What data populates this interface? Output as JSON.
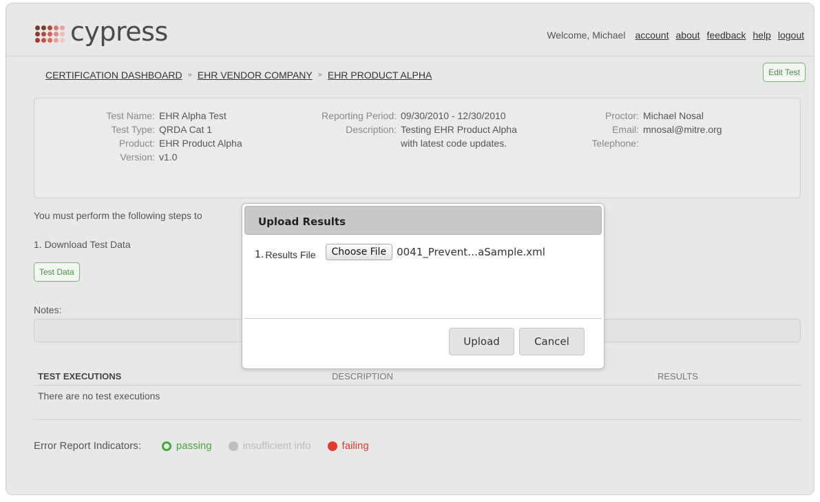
{
  "brand": {
    "name": "cypress",
    "dot_colors": [
      "#7a3a2a",
      "#7a3a2a",
      "#a84a37",
      "#d9786a",
      "#e7a39b",
      "#8e3b2a",
      "#b44a3a",
      "#d0625a",
      "#e08c83",
      "#ecbcb5",
      "#a13c2d",
      "#c8503f",
      "#dc6e63",
      "#e9a097",
      "#f2c8c2"
    ]
  },
  "topnav": {
    "welcome": "Welcome, Michael",
    "links": [
      "account",
      "about",
      "feedback",
      "help",
      "logout"
    ]
  },
  "breadcrumb": {
    "items": [
      "CERTIFICATION DASHBOARD",
      "EHR VENDOR COMPANY",
      "EHR PRODUCT ALPHA"
    ],
    "separator": "»"
  },
  "edit_test_label": "Edit Test",
  "test_info": {
    "col1": [
      {
        "label": "Test Name:",
        "value": "EHR Alpha Test"
      },
      {
        "label": "Test Type:",
        "value": "QRDA Cat 1"
      },
      {
        "label": "Product:",
        "value": "EHR Product Alpha"
      },
      {
        "label": "Version:",
        "value": "v1.0"
      }
    ],
    "col2": [
      {
        "label": "Reporting Period:",
        "value": "09/30/2010 - 12/30/2010"
      },
      {
        "label": "Description:",
        "value": "Testing EHR Product Alpha with latest code updates."
      }
    ],
    "col3": [
      {
        "label": "Proctor:",
        "value": "Michael Nosal"
      },
      {
        "label": "Email:",
        "value": "mnosal@mitre.org"
      },
      {
        "label": "Telephone:",
        "value": ""
      }
    ]
  },
  "steps": {
    "intro": "You must perform the following steps to",
    "step1": "1. Download Test Data",
    "test_data_button": "Test Data"
  },
  "notes": {
    "label": "Notes:",
    "value": ""
  },
  "executions": {
    "headers": [
      "TEST EXECUTIONS",
      "DESCRIPTION",
      "RESULTS"
    ],
    "empty_text": "There are no test executions"
  },
  "legend": {
    "title": "Error Report Indicators:",
    "items": [
      {
        "label": "passing",
        "color": "#44a83a"
      },
      {
        "label": "insufficient info",
        "color": "#bfbfbf"
      },
      {
        "label": "failing",
        "color": "#e23b2e"
      }
    ]
  },
  "modal": {
    "title": "Upload Results",
    "field_number": "1.",
    "field_label": "Results File",
    "choose_file_label": "Choose File",
    "file_name": "0041_Prevent…aSample.xml",
    "upload_label": "Upload",
    "cancel_label": "Cancel"
  }
}
